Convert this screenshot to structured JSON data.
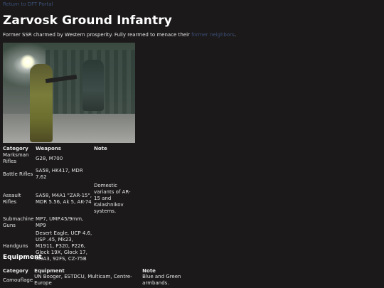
{
  "nav": {
    "back_label": "Return to DFT Portal"
  },
  "page": {
    "title": "Zarvosk Ground Infantry",
    "intro_text": "Former SSR charmed by Western prosperity. Fully rearmed to menace their ",
    "intro_link": "former neighbors",
    "intro_end": "."
  },
  "weapons_table": {
    "headers": [
      "Category",
      "Weapons",
      "Note"
    ],
    "rows": [
      {
        "category": "Marksman Rifles",
        "weapons": "G28, M700",
        "note": ""
      },
      {
        "category": "Battle Rifles",
        "weapons": "SA58, HK417, MDR 7.62",
        "note": ""
      },
      {
        "category": "Assault Rifles",
        "weapons": "SA58, M4A1 \"ZAR-15\", MDR 5.56, Ak 5, AK-74",
        "note": "Domestic variants of AR-15 and Kalashnikov systems."
      },
      {
        "category": "Submachine Guns",
        "weapons": "MP7, UMP.45/9mm, MP9",
        "note": ""
      },
      {
        "category": "Handguns",
        "weapons": "Desert Eagle, UCP 4.6, USP .45, Mk23, M1911, P320, P226, Glock 19X, Glock 17, M9A3, 92FS, CZ-75B",
        "note": ""
      }
    ]
  },
  "equipment": {
    "heading": "Equipment",
    "headers": [
      "Category",
      "Equipment",
      "Note"
    ],
    "rows": [
      {
        "category": "Camouflage",
        "equipment": "UN Booger, ESTDCU, Multicam, Centre-Europe",
        "note": "Blue and Green armbands."
      }
    ]
  },
  "colors": {
    "background": "#1b1919",
    "link": "#3b4f78",
    "text": "#e6e6e6"
  },
  "image": {
    "icon": "infantry-photo"
  }
}
